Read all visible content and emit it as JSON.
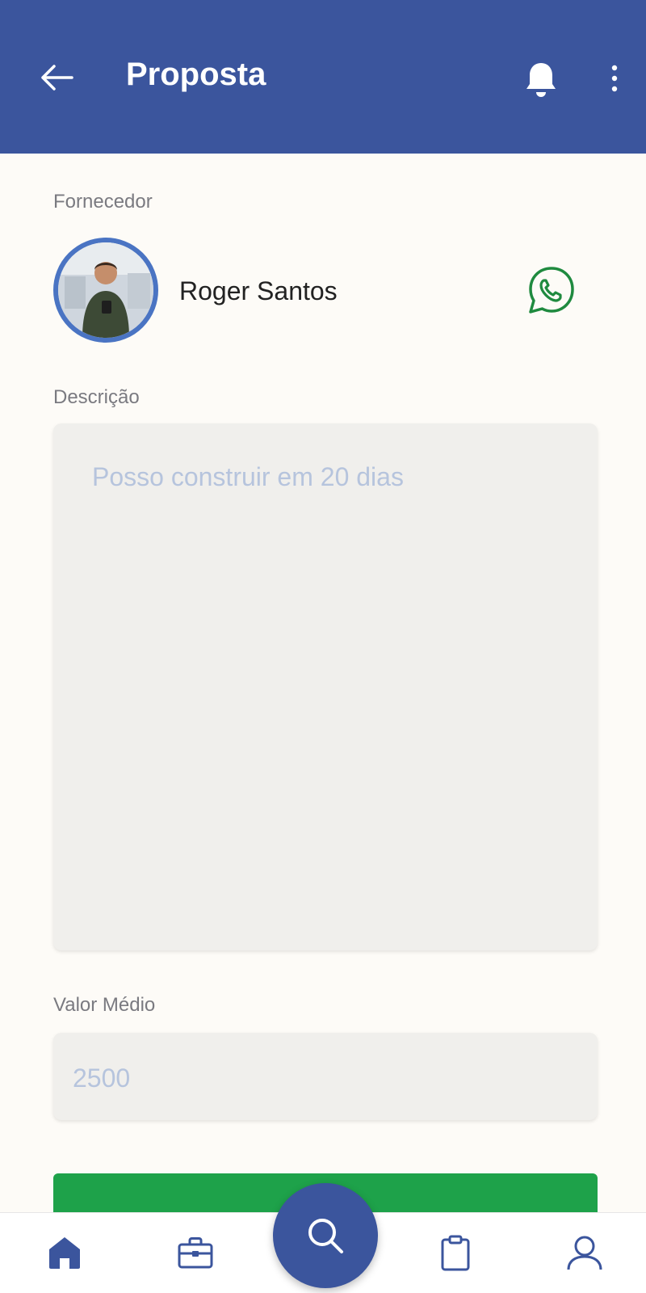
{
  "header": {
    "title": "Proposta",
    "back_icon": "arrow-left-icon",
    "notification_icon": "bell-icon",
    "menu_icon": "more-vert-icon",
    "background": "#3b559d"
  },
  "supplier": {
    "label": "Fornecedor",
    "name": "Roger Santos",
    "contact_icon": "whatsapp-icon",
    "contact_color": "#1f8a3f"
  },
  "description": {
    "label": "Descrição",
    "placeholder": "Posso construir em 20 dias"
  },
  "average_value": {
    "label": "Valor Médio",
    "placeholder": "2500"
  },
  "submit_button": {
    "color": "#1ea24a"
  },
  "bottom_nav": {
    "items": [
      "home-icon",
      "briefcase-icon",
      "search-icon",
      "clipboard-icon",
      "user-icon"
    ],
    "active": "home-icon"
  }
}
